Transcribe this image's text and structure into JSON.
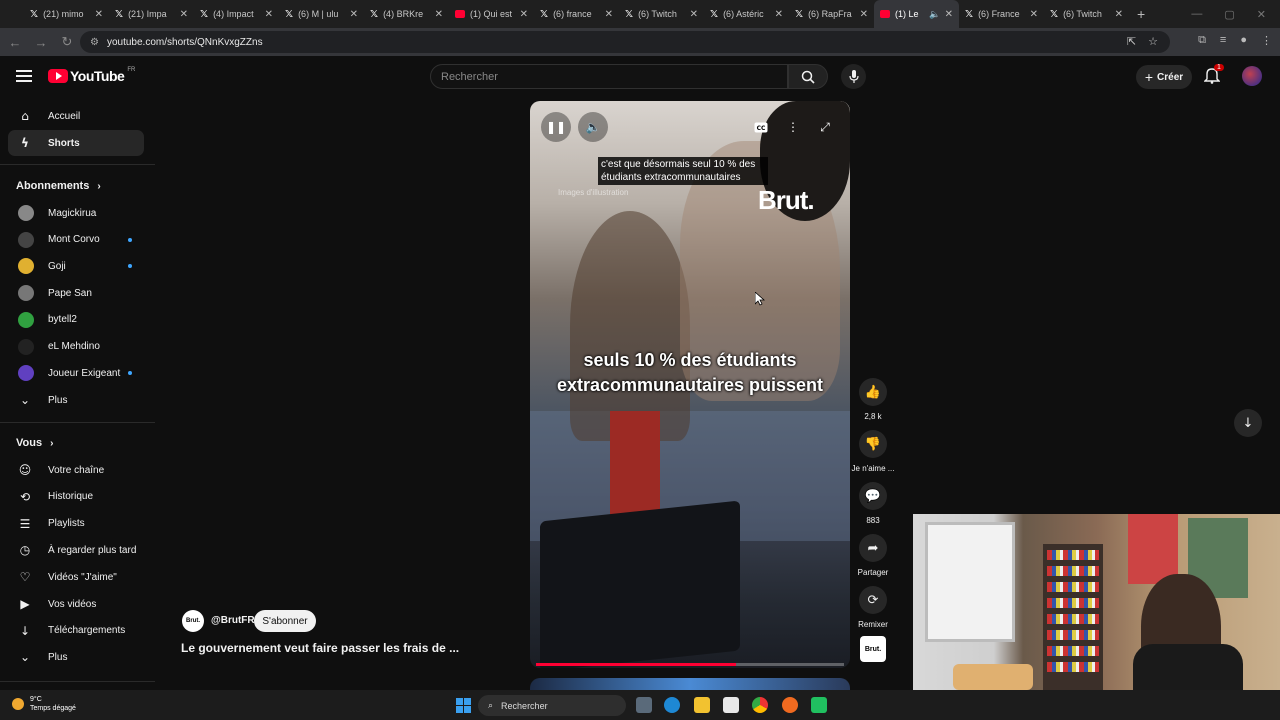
{
  "browser": {
    "tabs": [
      {
        "icon": "x-icon",
        "title": "(21) mimo"
      },
      {
        "icon": "x-icon",
        "title": "(21) Impa"
      },
      {
        "icon": "x-icon",
        "title": "(4) Impact"
      },
      {
        "icon": "x-icon",
        "title": "(6) M | ulu"
      },
      {
        "icon": "x-icon",
        "title": "(4) BRKre"
      },
      {
        "icon": "youtube-icon",
        "title": "(1) Qui est"
      },
      {
        "icon": "x-icon",
        "title": "(6) france"
      },
      {
        "icon": "x-icon",
        "title": "(6) Twitch"
      },
      {
        "icon": "x-icon",
        "title": "(6) Astéric"
      },
      {
        "icon": "x-icon",
        "title": "(6) RapFra"
      },
      {
        "icon": "youtube-icon",
        "title": "(1) Le",
        "active": true
      },
      {
        "icon": "x-icon",
        "title": "(6) France"
      },
      {
        "icon": "x-icon",
        "title": "(6) Twitch"
      }
    ],
    "url": "youtube.com/shorts/QNnKvxgZZns"
  },
  "header": {
    "logo_text": "YouTube",
    "region": "FR",
    "search_placeholder": "Rechercher",
    "create_label": "Créer",
    "notification_count": "1"
  },
  "sidebar": {
    "main": [
      {
        "label": "Accueil",
        "icon": "home-icon"
      },
      {
        "label": "Shorts",
        "icon": "shorts-icon",
        "active": true
      }
    ],
    "subscriptions_title": "Abonnements",
    "subscriptions": [
      {
        "label": "Magickirua",
        "color": "#888888",
        "dot": false
      },
      {
        "label": "Mont Corvo",
        "color": "#444444",
        "dot": true
      },
      {
        "label": "Goji",
        "color": "#e0b030",
        "dot": true
      },
      {
        "label": "Pape San",
        "color": "#777777",
        "dot": false
      },
      {
        "label": "bytell2",
        "color": "#30a040",
        "dot": false
      },
      {
        "label": "eL Mehdino",
        "color": "#222222",
        "dot": false
      },
      {
        "label": "Joueur Exigeant",
        "color": "#6040c0",
        "dot": true
      }
    ],
    "subs_more": "Plus",
    "you_title": "Vous",
    "you": [
      {
        "label": "Votre chaîne",
        "icon": "channel-icon"
      },
      {
        "label": "Historique",
        "icon": "history-icon"
      },
      {
        "label": "Playlists",
        "icon": "playlist-icon"
      },
      {
        "label": "À regarder plus tard",
        "icon": "watch-later-icon"
      },
      {
        "label": "Vidéos \"J'aime\"",
        "icon": "like-icon"
      },
      {
        "label": "Vos vidéos",
        "icon": "video-icon"
      },
      {
        "label": "Téléchargements",
        "icon": "download-icon"
      }
    ],
    "you_more": "Plus"
  },
  "short": {
    "top_caption": "c'est que désormais seul 10 % des étudiants extracommunautaires",
    "illustration_note": "Images d'illustration",
    "watermark": "Brut.",
    "big_caption": "seuls 10 % des étudiants extracommunautaires puissent",
    "progress": 0.65,
    "channel_avatar": "Brut.",
    "channel": "@BrutFR",
    "subscribe_label": "S'abonner",
    "title": "Le gouvernement veut faire passer les frais de ..."
  },
  "actions": {
    "likes": "2,8 k",
    "dislike_label": "Je n'aime ...",
    "comments": "883",
    "share_label": "Partager",
    "remix_label": "Remixer",
    "sound_label": "Brut."
  },
  "taskbar": {
    "temperature": "9°C",
    "weather": "Temps dégagé",
    "search_label": "Rechercher"
  }
}
